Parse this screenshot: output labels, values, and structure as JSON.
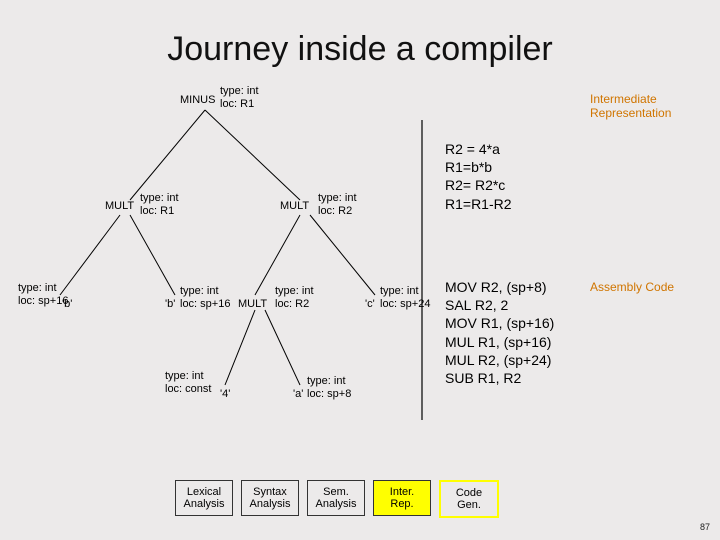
{
  "title": "Journey inside a compiler",
  "ir_heading": "Intermediate\nRepresentation",
  "asm_heading": "Assembly\nCode",
  "ir_lines": "R2 = 4*a\nR1=b*b\nR2= R2*c\nR1=R1-R2",
  "asm_lines": "MOV R2, (sp+8)\nSAL R2, 2\nMOV R1, (sp+16)\nMUL R1, (sp+16)\nMUL R2, (sp+24)\nSUB R1, R2",
  "ops": {
    "minus": "MINUS",
    "mult": "MULT"
  },
  "attrs": {
    "minus": "type: int\nloc: R1",
    "multL": "type: int\nloc: R1",
    "multR": "type: int\nloc: R2",
    "leaf_b1": "type: int\nloc: sp+16",
    "leaf_b2": "type: int\nloc: sp+16",
    "leaf_mult3": "type: int\nloc: R2",
    "leaf_c": "type: int\nloc: sp+24",
    "leaf_4": "type: int\nloc: const",
    "leaf_a": "type: int\nloc: sp+8"
  },
  "leaves": {
    "b1": "'b'",
    "b2": "'b'",
    "c": "'c'",
    "four": "'4'",
    "a": "'a'"
  },
  "phases": {
    "p1": "Lexical\nAnalysis",
    "p2": "Syntax\nAnalysis",
    "p3": "Sem.\nAnalysis",
    "p4": "Inter.\nRep.",
    "p5": "Code\nGen."
  },
  "page": "87"
}
